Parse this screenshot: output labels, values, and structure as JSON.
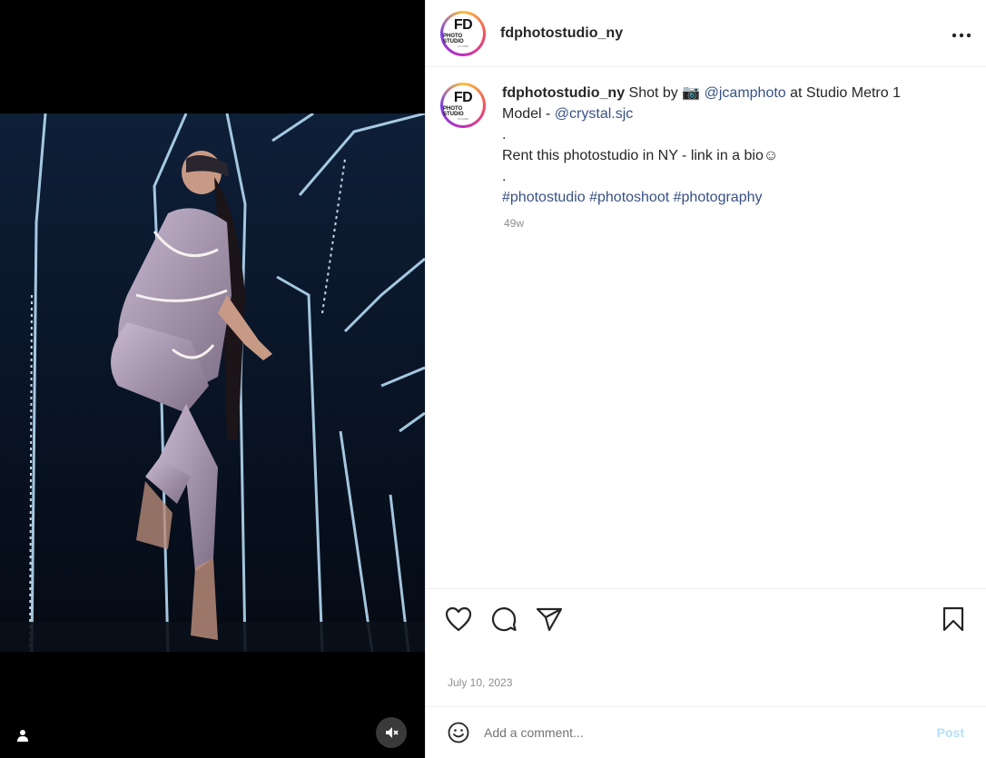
{
  "post": {
    "username": "fdphotostudio_ny",
    "avatar_logo": {
      "main": "FD",
      "sub": "PHOTO STUDIO",
      "tiny": "NY.COM"
    },
    "caption": {
      "username": "fdphotostudio_ny",
      "part1": " Shot by ",
      "camera_emoji": "📷",
      "mention1": "@jcamphoto",
      "part2": " at Studio Metro 1",
      "model_prefix": "Model - ",
      "mention2": "@crystal.sjc",
      "dot": ".",
      "rent_line": "Rent this photostudio in NY - link in a bio☺",
      "tags": [
        "#photostudio",
        "#photoshoot",
        "#photography"
      ]
    },
    "relative_time": "49w",
    "date": "July 10, 2023"
  },
  "comment": {
    "placeholder": "Add a comment...",
    "post_label": "Post"
  },
  "icons": {
    "more": "more-options-icon",
    "like": "heart-icon",
    "comment": "comment-icon",
    "share": "send-icon",
    "save": "bookmark-icon",
    "emoji": "emoji-icon",
    "mute": "muted-speaker-icon",
    "tags": "user-tag-icon"
  },
  "colors": {
    "link": "#385185",
    "muted_text": "#8e8e8e",
    "post_button_disabled": "#b2dffc"
  }
}
